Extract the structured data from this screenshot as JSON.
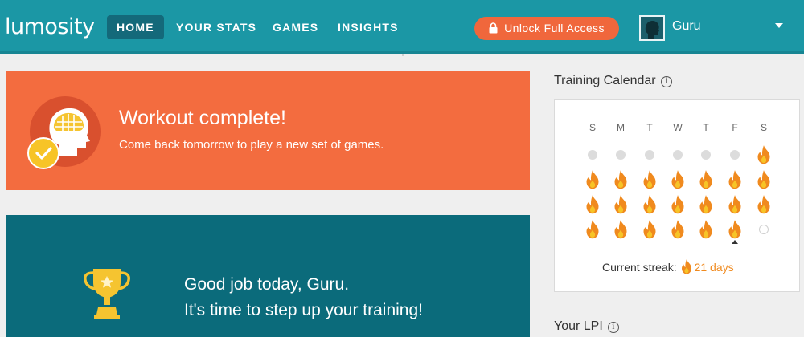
{
  "nav": {
    "logo": "lumosity",
    "items": [
      {
        "label": "HOME",
        "active": true
      },
      {
        "label": "YOUR STATS",
        "active": false
      },
      {
        "label": "GAMES",
        "active": false
      },
      {
        "label": "INSIGHTS",
        "active": false
      }
    ],
    "unlock_label": "Unlock Full Access",
    "user_name": "Guru"
  },
  "workout": {
    "title": "Workout complete!",
    "subtitle": "Come back tomorrow to play a new set of games."
  },
  "training": {
    "line1": "Good job today, Guru.",
    "line2": "It's time to step up your training!"
  },
  "calendar": {
    "title": "Training Calendar",
    "days": [
      "S",
      "M",
      "T",
      "W",
      "T",
      "F",
      "S"
    ],
    "weeks": [
      [
        "none",
        "none",
        "none",
        "none",
        "none",
        "none",
        "played"
      ],
      [
        "played",
        "played",
        "played",
        "played",
        "played",
        "played",
        "played"
      ],
      [
        "played",
        "played",
        "played",
        "played",
        "played",
        "played",
        "played"
      ],
      [
        "played",
        "played",
        "played",
        "played",
        "played",
        "played-today",
        "future"
      ]
    ],
    "streak_label": "Current streak:",
    "streak_value": "21 days"
  },
  "lpi": {
    "title": "Your LPI"
  },
  "colors": {
    "nav": "#1b97a5",
    "accent_orange": "#f36c3f",
    "teal_card": "#0b6b7b",
    "flame": "#f08a1e"
  }
}
